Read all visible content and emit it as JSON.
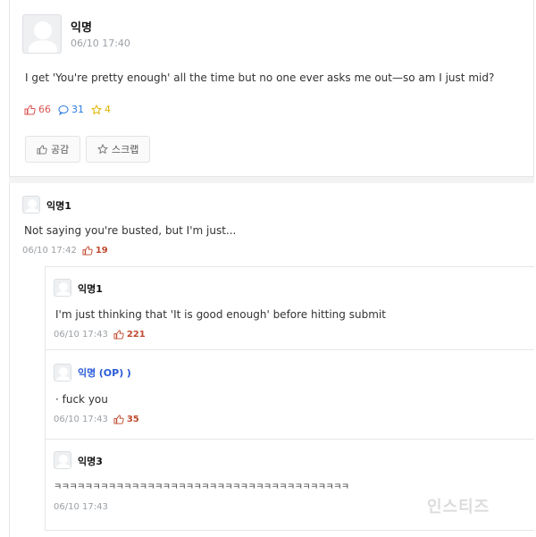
{
  "post": {
    "author": "익명",
    "time": "06/10 17:40",
    "body": "I get 'You're pretty enough' all the time but no one ever asks me out—so am I just mid?",
    "likes": "66",
    "comments": "31",
    "scraps": "4",
    "like_button": "공감",
    "scrap_button": "스크랩"
  },
  "comments": [
    {
      "author": "익명1",
      "text": "Not saying you're busted, but I'm just...",
      "time": "06/10 17:42",
      "likes": "19"
    }
  ],
  "replies": [
    {
      "author": "익명1",
      "text": "I'm just thinking that 'It is good enough' before hitting submit",
      "time": "06/10 17:43",
      "likes": "221"
    },
    {
      "author": "익명",
      "op_tag": "(OP)",
      "close_paren": ")",
      "text": "· fuck you",
      "time": "06/10 17:43",
      "likes": "35"
    },
    {
      "author": "익명3",
      "text": "ㅋㅋㅋㅋㅋㅋㅋㅋㅋㅋㅋㅋㅋㅋㅋㅋㅋㅋㅋㅋㅋㅋㅋㅋㅋㅋㅋㅋㅋㅋㅋㅋㅋㅋㅋㅋㅋㅋ",
      "time": "06/10 17:43"
    }
  ],
  "watermark": "인스티즈",
  "colors": {
    "like": "#d9534f",
    "comment": "#2a7ae2",
    "scrap": "#e0b400",
    "op": "#2a5bd7"
  }
}
